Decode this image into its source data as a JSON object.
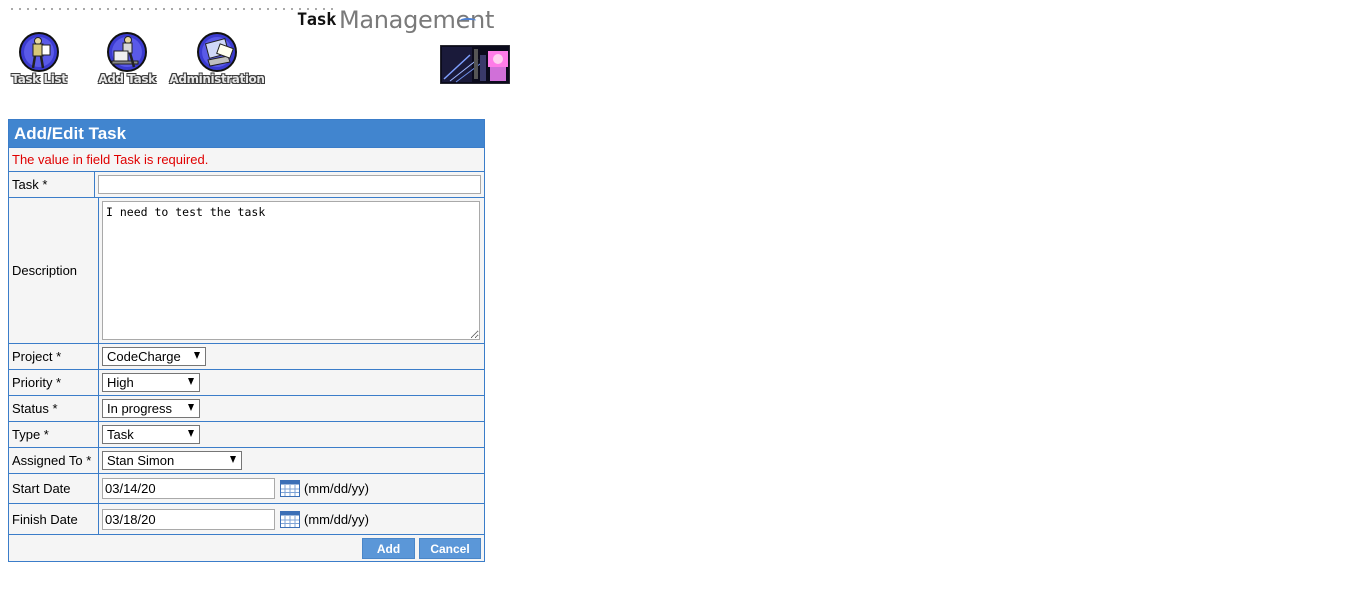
{
  "brand": {
    "prefix": "Task",
    "name": "Management"
  },
  "nav": [
    {
      "label": "Task List",
      "icon": "person-with-list-icon"
    },
    {
      "label": "Add Task",
      "icon": "person-at-computer-icon"
    },
    {
      "label": "Administration",
      "icon": "admin-monitor-icon"
    }
  ],
  "form": {
    "title": "Add/Edit Task",
    "error": "The value in field Task is required.",
    "task": {
      "label": "Task *",
      "value": ""
    },
    "description": {
      "label": "Description",
      "value": "I need to test the task"
    },
    "project": {
      "label": "Project *",
      "value": "CodeCharge"
    },
    "priority": {
      "label": "Priority *",
      "value": "High"
    },
    "status": {
      "label": "Status *",
      "value": "In progress"
    },
    "type": {
      "label": "Type *",
      "value": "Task"
    },
    "assigned": {
      "label": "Assigned To *",
      "value": "Stan Simon"
    },
    "start_date": {
      "label": "Start Date",
      "value": "03/14/20",
      "hint": "(mm/dd/yy)"
    },
    "finish_date": {
      "label": "Finish Date",
      "value": "03/18/20",
      "hint": "(mm/dd/yy)"
    },
    "buttons": {
      "add": "Add",
      "cancel": "Cancel"
    }
  },
  "colors": {
    "header_blue": "#4185cf",
    "border_blue": "#3b7dc9",
    "button_blue": "#5b97d8",
    "error_red": "#e00000"
  }
}
